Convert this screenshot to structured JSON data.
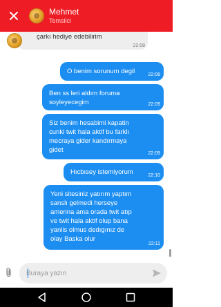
{
  "header": {
    "title": "Mehmet",
    "subtitle": "Temsilci",
    "background": "#ee1c24"
  },
  "messages": [
    {
      "direction": "in",
      "text": "çarkı hediye edebilirim",
      "time": "22:08"
    },
    {
      "direction": "out",
      "lines": [
        "O benim sorunum degil"
      ],
      "time": "22:08"
    },
    {
      "direction": "out",
      "lines": [
        "Ben ss leri aldım foruma",
        "soyleyecegim"
      ],
      "time": "22:09"
    },
    {
      "direction": "out",
      "lines": [
        "Siz benim hesabimi kapatin",
        "cunki twit hala aktif bu farklı",
        "mecraya gider kandırmaya",
        "gidet"
      ],
      "time": "22:09"
    },
    {
      "direction": "out",
      "lines": [
        "Hıcbısey istemiyorum"
      ],
      "time": "22:10"
    },
    {
      "direction": "out",
      "lines": [
        "Yeni sitesiniz yatırım yaptım",
        "sanslı gelmedi herseye",
        "amenna ama orada twit atıp",
        "ve twit hala aktif olup bana",
        "yanlis olmus dedıgınız de",
        "olay Baska olur"
      ],
      "time": "22:11"
    }
  ],
  "composer": {
    "placeholder": "Buraya yazın",
    "attach_icon": "paperclip-icon",
    "send_icon": "send-icon"
  },
  "colors": {
    "accent": "#ee1c24",
    "outgoing_bubble": "#1c8ef2",
    "incoming_bubble": "#eeeeee"
  },
  "navbar": {
    "icons": [
      "back-icon",
      "home-icon",
      "recents-icon"
    ]
  }
}
